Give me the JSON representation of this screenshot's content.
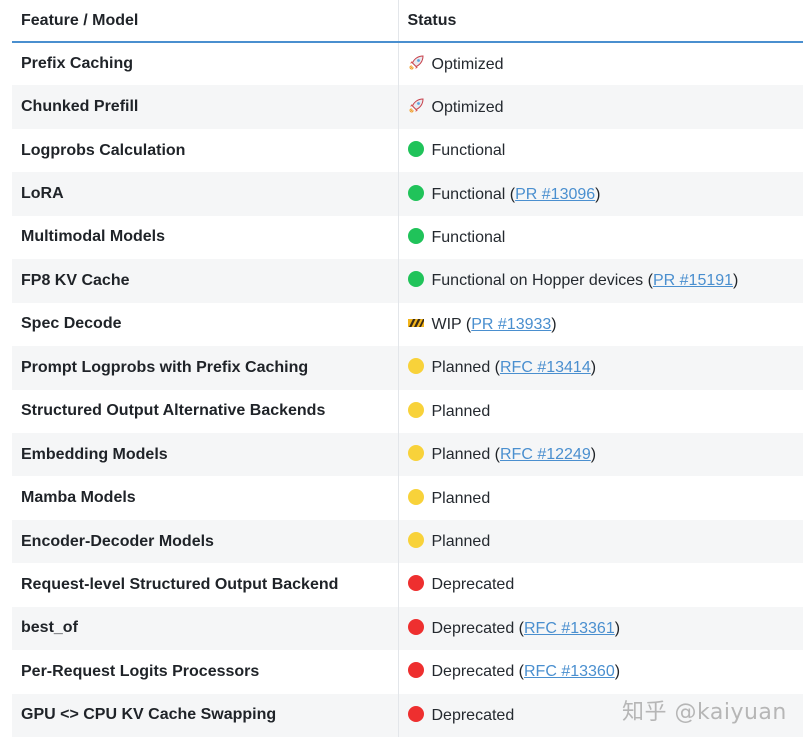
{
  "table": {
    "headers": {
      "feature": "Feature / Model",
      "status": "Status"
    },
    "rows": [
      {
        "feature": "Prefix Caching",
        "icon": "rocket-icon",
        "status": "Optimized",
        "link": ""
      },
      {
        "feature": "Chunked Prefill",
        "icon": "rocket-icon",
        "status": "Optimized",
        "link": ""
      },
      {
        "feature": "Logprobs Calculation",
        "icon": "green-circle-icon",
        "status": "Functional",
        "link": ""
      },
      {
        "feature": "LoRA",
        "icon": "green-circle-icon",
        "status": "Functional",
        "link": "PR #13096"
      },
      {
        "feature": "Multimodal Models",
        "icon": "green-circle-icon",
        "status": "Functional",
        "link": ""
      },
      {
        "feature": "FP8 KV Cache",
        "icon": "green-circle-icon",
        "status": "Functional on Hopper devices",
        "link": "PR #15191"
      },
      {
        "feature": "Spec Decode",
        "icon": "construction-icon",
        "status": "WIP",
        "link": "PR #13933"
      },
      {
        "feature": "Prompt Logprobs with Prefix Caching",
        "icon": "yellow-circle-icon",
        "status": "Planned",
        "link": "RFC #13414"
      },
      {
        "feature": "Structured Output Alternative Backends",
        "icon": "yellow-circle-icon",
        "status": "Planned",
        "link": ""
      },
      {
        "feature": "Embedding Models",
        "icon": "yellow-circle-icon",
        "status": "Planned",
        "link": "RFC #12249"
      },
      {
        "feature": "Mamba Models",
        "icon": "yellow-circle-icon",
        "status": "Planned",
        "link": ""
      },
      {
        "feature": "Encoder-Decoder Models",
        "icon": "yellow-circle-icon",
        "status": "Planned",
        "link": ""
      },
      {
        "feature": "Request-level Structured Output Backend",
        "icon": "red-circle-icon",
        "status": "Deprecated",
        "link": ""
      },
      {
        "feature": "best_of",
        "icon": "red-circle-icon",
        "status": "Deprecated",
        "link": "RFC #13361"
      },
      {
        "feature": "Per-Request Logits Processors",
        "icon": "red-circle-icon",
        "status": "Deprecated",
        "link": "RFC #13360"
      },
      {
        "feature": "GPU <> CPU KV Cache Swapping",
        "icon": "red-circle-icon",
        "status": "Deprecated",
        "link": ""
      }
    ]
  },
  "colors": {
    "link": "#4a8fcf",
    "header_rule": "#4a8fcf",
    "green": "#20c35a",
    "yellow": "#f8d23a",
    "red": "#ee2f2f"
  },
  "watermark": "知乎 @kaiyuan"
}
